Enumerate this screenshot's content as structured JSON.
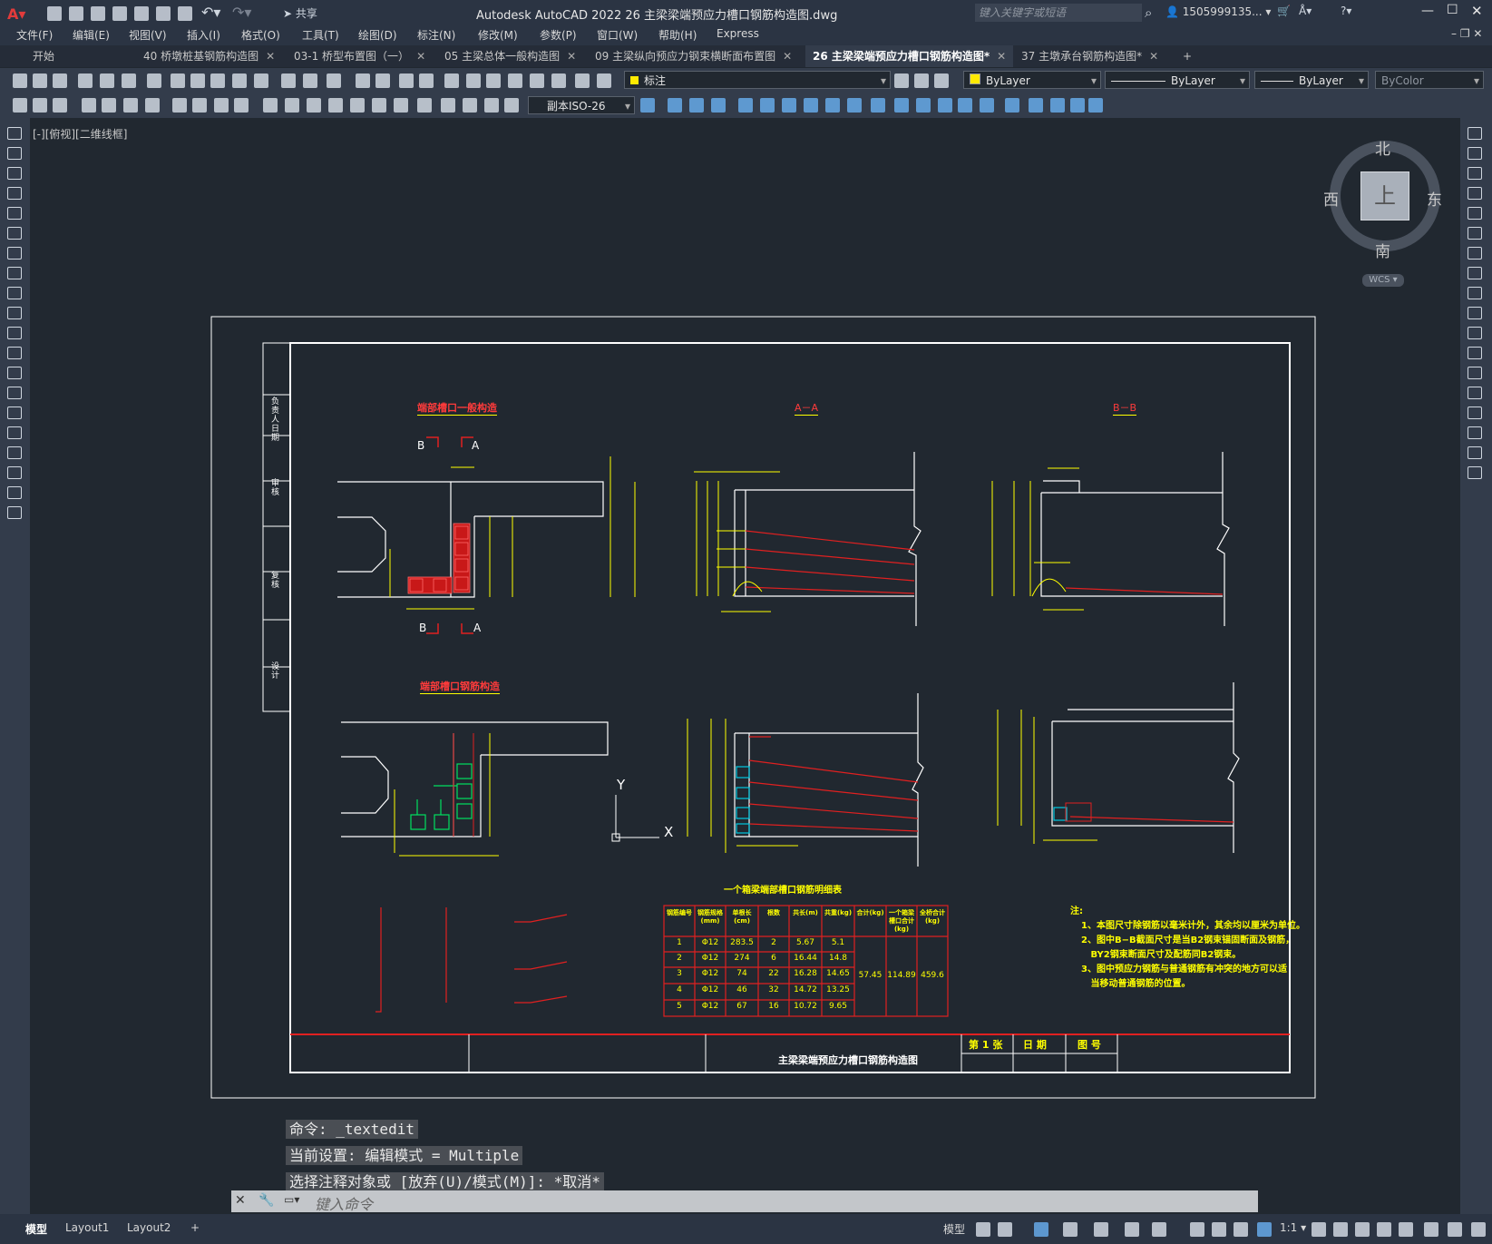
{
  "window": {
    "title": "Autodesk AutoCAD 2022   26 主梁梁端预应力槽口钢筋构造图.dwg",
    "share_label": "共享",
    "search_placeholder": "键入关键字或短语",
    "user": "1505999135..."
  },
  "menu": [
    "文件(F)",
    "编辑(E)",
    "视图(V)",
    "插入(I)",
    "格式(O)",
    "工具(T)",
    "绘图(D)",
    "标注(N)",
    "修改(M)",
    "参数(P)",
    "窗口(W)",
    "帮助(H)",
    "Express"
  ],
  "tabs": [
    {
      "label": "开始",
      "active": false
    },
    {
      "label": "40 桥墩桩基钢筋构造图",
      "active": false
    },
    {
      "label": "03-1 桥型布置图（一）",
      "active": false
    },
    {
      "label": "05 主梁总体一般构造图",
      "active": false
    },
    {
      "label": "09 主梁纵向预应力钢束横断面布置图",
      "active": false
    },
    {
      "label": "26 主梁梁端预应力槽口钢筋构造图*",
      "active": true
    },
    {
      "label": "37 主墩承台钢筋构造图*",
      "active": false
    }
  ],
  "toolbar": {
    "layer_value": "标注",
    "color_value": "ByLayer",
    "linetype_value": "ByLayer",
    "lineweight_value": "ByLayer",
    "plotstyle_value": "ByColor",
    "dimstyle_value": "副本ISO-26"
  },
  "viewport_label": "[-][俯视][二维线框]",
  "viewcube": {
    "north": "北",
    "south": "南",
    "east": "东",
    "west": "西",
    "top": "上",
    "wcs": "WCS"
  },
  "drawing": {
    "title_general": "端部槽口一般构造",
    "title_aa": "A－A",
    "title_bb": "B－B",
    "title_rebar": "端部槽口钢筋构造",
    "section_b": "B",
    "section_a": "A",
    "table_title": "一个箱梁端部槽口钢筋明细表",
    "table_headers": [
      "钢筋编号",
      "钢筋规格(mm)",
      "单根长(cm)",
      "根数",
      "共长(m)",
      "共重(kg)",
      "合计(kg)",
      "一个箱梁槽口合计(kg)",
      "全桥合计(kg)"
    ],
    "table_rows": [
      [
        "1",
        "Φ12",
        "283.5",
        "2",
        "5.67",
        "5.1"
      ],
      [
        "2",
        "Φ12",
        "274",
        "6",
        "16.44",
        "14.8"
      ],
      [
        "3",
        "Φ12",
        "74",
        "22",
        "16.28",
        "14.65"
      ],
      [
        "4",
        "Φ12",
        "46",
        "32",
        "14.72",
        "13.25"
      ],
      [
        "5",
        "Φ12",
        "67",
        "16",
        "10.72",
        "9.65"
      ]
    ],
    "table_total": "57.45",
    "table_box_total": "114.89",
    "table_bridge_total": "459.6",
    "notes_title": "注:",
    "notes": [
      "1、本图尺寸除钢筋以毫米计外，其余均以厘米为单位。",
      "2、图中B−B截面尺寸是当B2钢束锚固断面及钢筋，",
      "   BY2钢束断面尺寸及配筋同B2钢束。",
      "3、图中预应力钢筋与普通钢筋有冲突的地方可以适",
      "   当移动普通钢筋的位置。"
    ],
    "sheet_title": "主梁梁端预应力槽口钢筋构造图",
    "sheet_page": "第 1 张",
    "sheet_date": "日 期",
    "sheet_no": "图 号",
    "side_labels": [
      "负责人 日期",
      "审 核",
      "复 核",
      "设 计"
    ],
    "ucs_x": "X",
    "ucs_y": "Y"
  },
  "command": {
    "line1": "命令: _textedit",
    "line2": "当前设置: 编辑模式 = Multiple",
    "line3": "选择注释对象或 [放弃(U)/模式(M)]: *取消*",
    "input_placeholder": "键入命令"
  },
  "status": {
    "layout_tabs": [
      "模型",
      "Layout1",
      "Layout2"
    ],
    "model_label": "模型",
    "scale": "1:1"
  }
}
